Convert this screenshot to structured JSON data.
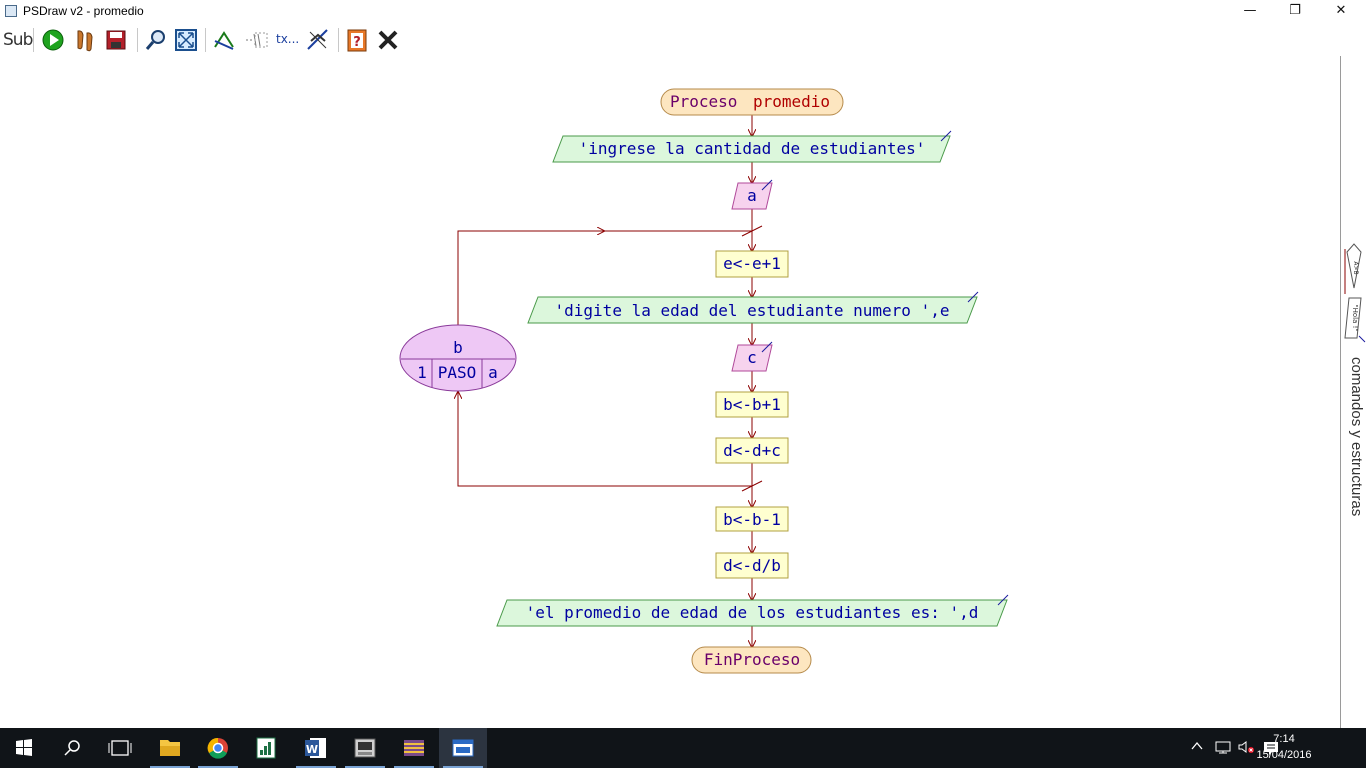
{
  "window": {
    "title": "PSDraw v2 - promedio",
    "minimize_glyph": "—",
    "restore_glyph": "❐",
    "close_glyph": "✕"
  },
  "toolbar": {
    "sub_label": "Sub",
    "text_tool_label": "tx...",
    "buttons": [
      "sub-icon",
      "run-icon",
      "step-icon",
      "save-image-icon",
      "zoom-icon",
      "fit-icon",
      "arrows-icon",
      "comment-icon",
      "text-icon",
      "cross-lines-icon",
      "help-icon",
      "close-icon"
    ]
  },
  "flowchart": {
    "start_keyword": "Proceso",
    "process_name": "promedio",
    "output1": "'ingrese la cantidad de estudiantes'",
    "input1": "a",
    "assign1": "e<-e+1",
    "output2": "'digite la edad del estudiante numero ',e",
    "input2": "c",
    "assign2": "b<-b+1",
    "assign3": "d<-d+c",
    "assign4": "b<-b-1",
    "assign5": "d<-d/b",
    "output3": "'el promedio de edad de los estudiantes es: ',d",
    "end": "FinProceso",
    "loop": {
      "variable": "b",
      "start": "1",
      "step": "PASO",
      "end": "a"
    }
  },
  "side_panel": {
    "label": "comandos y estructuras",
    "tab_condition": "A>B",
    "tab_text": "\"Hola !\""
  },
  "taskbar": {
    "time": "7:14",
    "date": "15/04/2016",
    "apps": [
      "start-icon",
      "search-icon",
      "task-view-icon",
      "file-explorer-icon",
      "chrome-icon",
      "excel-icon",
      "word-icon",
      "pseint-icon",
      "winrar-icon",
      "psdraw-icon"
    ]
  },
  "colors": {
    "arrow": "#8b0000",
    "terminal_fill": "#fde6c0",
    "io_fill": "#dcf7dc",
    "input_fill": "#f7d3ee",
    "assign_fill": "#ffffd0",
    "loop_fill": "#eec8f5",
    "text": "#0000a0"
  }
}
